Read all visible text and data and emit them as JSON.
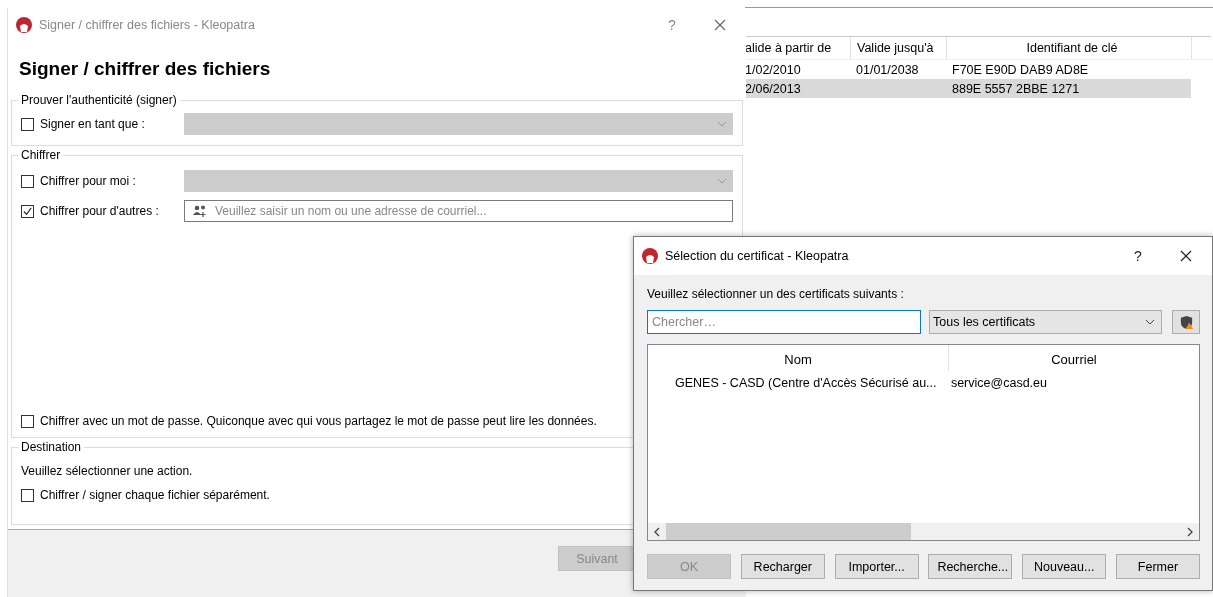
{
  "background_window": {
    "columns": [
      "alide à partir de",
      "Valide jusqu'à",
      "Identifiant de clé"
    ],
    "rows": [
      {
        "valid_from": "1/02/2010",
        "valid_until": "01/01/2038",
        "key_id": "F70E E90D DAB9 AD8E",
        "selected": false
      },
      {
        "valid_from": "2/06/2013",
        "key_id": "889E 5557 2BBE 1271",
        "selected": true
      }
    ]
  },
  "main_dialog": {
    "title": "Signer / chiffrer des fichiers - Kleopatra",
    "help": "?",
    "heading": "Signer / chiffrer des fichiers",
    "sign": {
      "legend": "Prouver l'authenticité (signer)",
      "option": {
        "label": "Signer en tant que :",
        "checked": false
      }
    },
    "encrypt": {
      "legend": "Chiffrer",
      "options": [
        {
          "kind": "combo",
          "label": "Chiffrer pour moi :",
          "checked": false
        },
        {
          "kind": "recipient",
          "label": "Chiffrer pour d'autres :",
          "checked": true,
          "placeholder": "Veuillez saisir un nom ou une adresse de courriel..."
        }
      ],
      "password": {
        "label": "Chiffrer avec un mot de passe. Quiconque avec qui vous partagez le mot de passe peut lire les données.",
        "checked": false
      }
    },
    "destination": {
      "legend": "Destination",
      "hint": "Veuillez sélectionner une action.",
      "option": {
        "label": "Chiffrer / signer chaque fichier séparément.",
        "checked": false
      }
    },
    "next_button": {
      "label": "Suivant",
      "disabled": true
    }
  },
  "certificate_dialog": {
    "title": "Sélection du certificat - Kleopatra",
    "help": "?",
    "prompt": "Veuillez sélectionner un des certificats suivants :",
    "search": {
      "placeholder": "Chercher…"
    },
    "filter": "Tous les certificats",
    "columns": [
      "Nom",
      "Courriel"
    ],
    "rows": [
      {
        "name": "GENES - CASD (Centre d'Accès Sécurisé au...",
        "email": "service@casd.eu"
      }
    ],
    "buttons": [
      {
        "label": "OK",
        "disabled": true
      },
      {
        "label": "Recharger",
        "disabled": false
      },
      {
        "label": "Importer...",
        "disabled": false
      },
      {
        "label": "Recherche...",
        "disabled": false
      },
      {
        "label": "Nouveau...",
        "disabled": false
      },
      {
        "label": "Fermer",
        "disabled": false
      }
    ]
  }
}
